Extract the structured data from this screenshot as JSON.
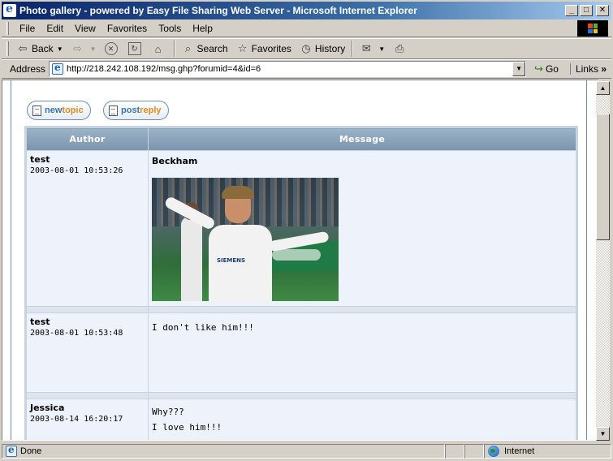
{
  "window": {
    "title": "Photo gallery - powered by Easy File Sharing Web Server - Microsoft Internet Explorer",
    "minimize": "_",
    "maximize": "□",
    "close": "✕"
  },
  "menu": {
    "items": [
      {
        "label": "File"
      },
      {
        "label": "Edit"
      },
      {
        "label": "View"
      },
      {
        "label": "Favorites"
      },
      {
        "label": "Tools"
      },
      {
        "label": "Help"
      }
    ]
  },
  "toolbar": {
    "back": "Back",
    "search": "Search",
    "favorites": "Favorites",
    "history": "History"
  },
  "address": {
    "label": "Address",
    "url": "http://218.242.108.192/msg.ghp?forumid=4&id=6",
    "go": "Go",
    "links": "Links",
    "links_more": "»"
  },
  "buttons": {
    "newtopic_a": "new",
    "newtopic_b": "topic",
    "postreply_a": "post",
    "postreply_b": "reply"
  },
  "table": {
    "headers": [
      "Author",
      "Message"
    ],
    "posts": [
      {
        "author": "test",
        "date": "2003-08-01 10:53:26",
        "title": "Beckham",
        "lines": []
      },
      {
        "author": "test",
        "date": "2003-08-01 10:53:48",
        "title": "",
        "lines": [
          "I don't like him!!!"
        ]
      },
      {
        "author": "Jessica",
        "date": "2003-08-14 16:20:17",
        "title": "",
        "lines": [
          "Why???",
          "I love him!!!"
        ]
      }
    ],
    "photo_sponsor": "SIEMENS"
  },
  "status": {
    "text": "Done",
    "zone": "Internet"
  },
  "colors": {
    "titlebar": "#0a246a",
    "header": "#7a95ae",
    "row": "#eef2fa",
    "accent_blue": "#3874a8",
    "accent_orange": "#e48a1c"
  }
}
